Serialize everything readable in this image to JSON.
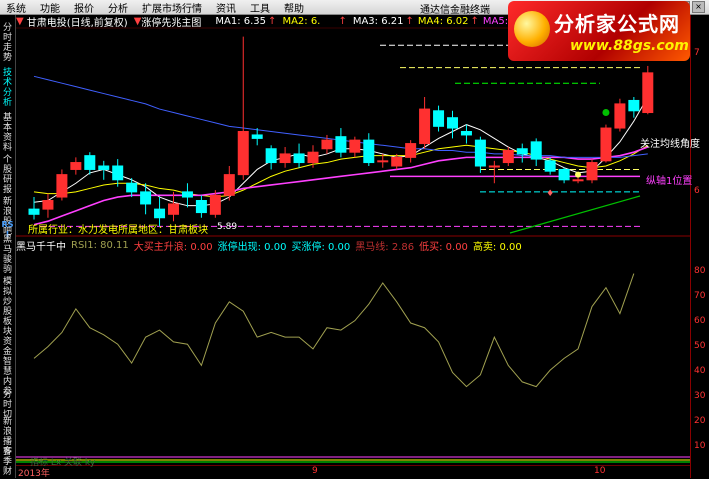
{
  "menu": {
    "items": [
      "系统",
      "功能",
      "报价",
      "分析",
      "扩展市场行情",
      "资讯",
      "工具",
      "帮助"
    ],
    "right_title": "通达信金融终端"
  },
  "sidebar": {
    "tabs": [
      "分时走势",
      "技术分析",
      "基本资料",
      "个股研报",
      "新浪股吧",
      "RSI",
      "黑马骏驹",
      "模拟炒股",
      "板块资金",
      "智慧内参",
      "分时切",
      "新浪播客",
      "多季",
      "财"
    ]
  },
  "title_row": {
    "stock": "甘肃电投",
    "mode": "(日线,前复权)",
    "indicator": "涨停先兆主图",
    "ma1": "MA1: 6.35",
    "ma2": "MA2: 6.",
    "ma3": "MA3: 6.21",
    "ma4": "MA4: 6.02",
    "ma5": "MA5: 6."
  },
  "logo": {
    "title": "分析家公式网",
    "url": "www.88gs.com"
  },
  "annotations": {
    "industry": "所属行业：水力发电所属地区：甘肃板块",
    "low_price": "5.89",
    "focus": "关注均线角度",
    "vertical": "纵轴1位置"
  },
  "sub_title": {
    "name": "黑马千千中",
    "rsi": "RSI1: 80.11",
    "main_buy": "大买主升浪: 0.00",
    "zt_appear": "涨停出现: 0.00",
    "buy_zt": "买涨停: 0.00",
    "heima": "黑马线: 2.86",
    "low_buy": "低买: 0.00",
    "high_sell": "高卖: 0.00"
  },
  "main_axis_ticks": [
    "7",
    "6"
  ],
  "sub_axis_ticks": [
    "80",
    "70",
    "60",
    "50",
    "40",
    "30",
    "20",
    "10"
  ],
  "bottom": {
    "dates": [
      "2013年",
      "9",
      "10"
    ],
    "left_label": "指标 Lx 关联 ky"
  },
  "colors": {
    "up": "#ff3030",
    "down": "#00ffff",
    "background": "#000000",
    "axis": "#8a0000"
  },
  "chart_data": [
    {
      "type": "candlestick",
      "candles": [
        {
          "o": 5.95,
          "c": 5.92,
          "h": 6.02,
          "l": 5.89
        },
        {
          "o": 5.95,
          "c": 6.0,
          "h": 6.04,
          "l": 5.9
        },
        {
          "o": 6.02,
          "c": 6.15,
          "h": 6.18,
          "l": 6.0
        },
        {
          "o": 6.18,
          "c": 6.22,
          "h": 6.25,
          "l": 6.15
        },
        {
          "o": 6.26,
          "c": 6.18,
          "h": 6.28,
          "l": 6.15
        },
        {
          "o": 6.2,
          "c": 6.18,
          "h": 6.23,
          "l": 6.12
        },
        {
          "o": 6.2,
          "c": 6.12,
          "h": 6.24,
          "l": 6.08
        },
        {
          "o": 6.1,
          "c": 6.05,
          "h": 6.13,
          "l": 6.02
        },
        {
          "o": 6.05,
          "c": 5.98,
          "h": 6.1,
          "l": 5.92
        },
        {
          "o": 5.95,
          "c": 5.9,
          "h": 6.02,
          "l": 5.85
        },
        {
          "o": 5.92,
          "c": 5.98,
          "h": 6.05,
          "l": 5.88
        },
        {
          "o": 6.05,
          "c": 6.02,
          "h": 6.1,
          "l": 5.96
        },
        {
          "o": 6.0,
          "c": 5.93,
          "h": 6.03,
          "l": 5.9
        },
        {
          "o": 5.92,
          "c": 6.03,
          "h": 6.06,
          "l": 5.9
        },
        {
          "o": 6.03,
          "c": 6.15,
          "h": 6.2,
          "l": 6.0
        },
        {
          "o": 6.15,
          "c": 6.4,
          "h": 6.95,
          "l": 6.12
        },
        {
          "o": 6.38,
          "c": 6.36,
          "h": 6.42,
          "l": 6.32
        },
        {
          "o": 6.3,
          "c": 6.22,
          "h": 6.32,
          "l": 6.18
        },
        {
          "o": 6.22,
          "c": 6.27,
          "h": 6.31,
          "l": 6.19
        },
        {
          "o": 6.27,
          "c": 6.22,
          "h": 6.33,
          "l": 6.19
        },
        {
          "o": 6.22,
          "c": 6.28,
          "h": 6.32,
          "l": 6.19
        },
        {
          "o": 6.3,
          "c": 6.35,
          "h": 6.38,
          "l": 6.27
        },
        {
          "o": 6.37,
          "c": 6.28,
          "h": 6.42,
          "l": 6.25
        },
        {
          "o": 6.28,
          "c": 6.35,
          "h": 6.37,
          "l": 6.25
        },
        {
          "o": 6.35,
          "c": 6.22,
          "h": 6.39,
          "l": 6.2
        },
        {
          "o": 6.23,
          "c": 6.23,
          "h": 6.27,
          "l": 6.19
        },
        {
          "o": 6.2,
          "c": 6.25,
          "h": 6.27,
          "l": 6.18
        },
        {
          "o": 6.25,
          "c": 6.33,
          "h": 6.35,
          "l": 6.22
        },
        {
          "o": 6.33,
          "c": 6.53,
          "h": 6.6,
          "l": 6.3
        },
        {
          "o": 6.52,
          "c": 6.43,
          "h": 6.55,
          "l": 6.4
        },
        {
          "o": 6.48,
          "c": 6.42,
          "h": 6.52,
          "l": 6.36
        },
        {
          "o": 6.4,
          "c": 6.38,
          "h": 6.44,
          "l": 6.33
        },
        {
          "o": 6.35,
          "c": 6.2,
          "h": 6.37,
          "l": 6.16
        },
        {
          "o": 6.2,
          "c": 6.2,
          "h": 6.23,
          "l": 6.1
        },
        {
          "o": 6.22,
          "c": 6.29,
          "h": 6.31,
          "l": 6.2
        },
        {
          "o": 6.3,
          "c": 6.27,
          "h": 6.33,
          "l": 6.22
        },
        {
          "o": 6.34,
          "c": 6.24,
          "h": 6.36,
          "l": 6.2
        },
        {
          "o": 6.23,
          "c": 6.17,
          "h": 6.25,
          "l": 6.15
        },
        {
          "o": 6.18,
          "c": 6.12,
          "h": 6.19,
          "l": 6.1
        },
        {
          "o": 6.12,
          "c": 6.12,
          "h": 6.15,
          "l": 6.1
        },
        {
          "o": 6.12,
          "c": 6.22,
          "h": 6.24,
          "l": 6.1
        },
        {
          "o": 6.23,
          "c": 6.42,
          "h": 6.44,
          "l": 6.22
        },
        {
          "o": 6.42,
          "c": 6.56,
          "h": 6.59,
          "l": 6.4
        },
        {
          "o": 6.58,
          "c": 6.52,
          "h": 6.6,
          "l": 6.48
        },
        {
          "o": 6.51,
          "c": 6.74,
          "h": 6.78,
          "l": 6.5
        }
      ],
      "ma_lines": [
        {
          "name": "MA1",
          "color": "#ffffff",
          "values": [
            5.99,
            6.0,
            6.05,
            6.1,
            6.16,
            6.18,
            6.15,
            6.12,
            6.08,
            6.02,
            5.99,
            5.97,
            5.97,
            5.98,
            6.02,
            6.1,
            6.18,
            6.23,
            6.25,
            6.27,
            6.25,
            6.27,
            6.3,
            6.3,
            6.29,
            6.27,
            6.25,
            6.26,
            6.31,
            6.36,
            6.4,
            6.44,
            6.41,
            6.36,
            6.31,
            6.27,
            6.25,
            6.23,
            6.19,
            6.16,
            6.17,
            6.25,
            6.34,
            6.46,
            6.6
          ]
        },
        {
          "name": "MA3",
          "color": "#ffff00",
          "values": [
            6.05,
            6.04,
            6.04,
            6.05,
            6.07,
            6.09,
            6.1,
            6.1,
            6.09,
            6.07,
            6.06,
            6.04,
            6.03,
            6.02,
            6.03,
            6.06,
            6.1,
            6.14,
            6.17,
            6.19,
            6.21,
            6.22,
            6.24,
            6.25,
            6.26,
            6.26,
            6.26,
            6.26,
            6.28,
            6.3,
            6.31,
            6.32,
            6.31,
            6.3,
            6.29,
            6.28,
            6.26,
            6.24,
            6.22,
            6.2,
            6.19,
            6.2,
            6.23,
            6.27,
            6.32
          ]
        },
        {
          "name": "MA4",
          "color": "#ff40ff",
          "values": [
            5.86,
            5.88,
            5.91,
            5.94,
            5.97,
            6.0,
            6.02,
            6.03,
            6.03,
            6.03,
            6.03,
            6.03,
            6.03,
            6.04,
            6.05,
            6.07,
            6.08,
            6.09,
            6.1,
            6.11,
            6.12,
            6.13,
            6.14,
            6.15,
            6.16,
            6.17,
            6.18,
            6.19,
            6.21,
            6.23,
            6.24,
            6.25,
            6.25,
            6.25,
            6.25,
            6.25,
            6.25,
            6.25,
            6.25,
            6.24,
            6.24,
            6.25,
            6.26,
            6.28,
            6.31
          ]
        },
        {
          "name": "MA5",
          "color": "#4060ff",
          "values": [
            6.72,
            6.7,
            6.68,
            6.66,
            6.64,
            6.62,
            6.6,
            6.58,
            6.56,
            6.53,
            6.51,
            6.49,
            6.47,
            6.45,
            6.43,
            6.42,
            6.41,
            6.4,
            6.39,
            6.38,
            6.37,
            6.36,
            6.35,
            6.34,
            6.33,
            6.32,
            6.31,
            6.3,
            6.3,
            6.29,
            6.29,
            6.28,
            6.28,
            6.27,
            6.27,
            6.26,
            6.26,
            6.26,
            6.25,
            6.25,
            6.25,
            6.25,
            6.25,
            6.26,
            6.27
          ]
        }
      ]
    },
    {
      "type": "line",
      "title": "黑马千千中",
      "series": [
        {
          "name": "RSI1",
          "color": "#a0a050",
          "values": [
            44,
            49,
            55,
            65,
            57,
            54,
            50,
            42,
            53,
            56,
            51,
            50,
            41,
            59,
            68,
            64,
            53,
            55,
            53,
            53,
            48,
            57,
            56,
            60,
            67,
            76,
            68,
            59,
            57,
            51,
            38,
            32,
            37,
            53,
            41,
            34,
            32,
            39,
            44,
            48,
            66,
            74,
            63,
            80
          ]
        }
      ],
      "ylim": [
        0,
        90
      ]
    }
  ]
}
